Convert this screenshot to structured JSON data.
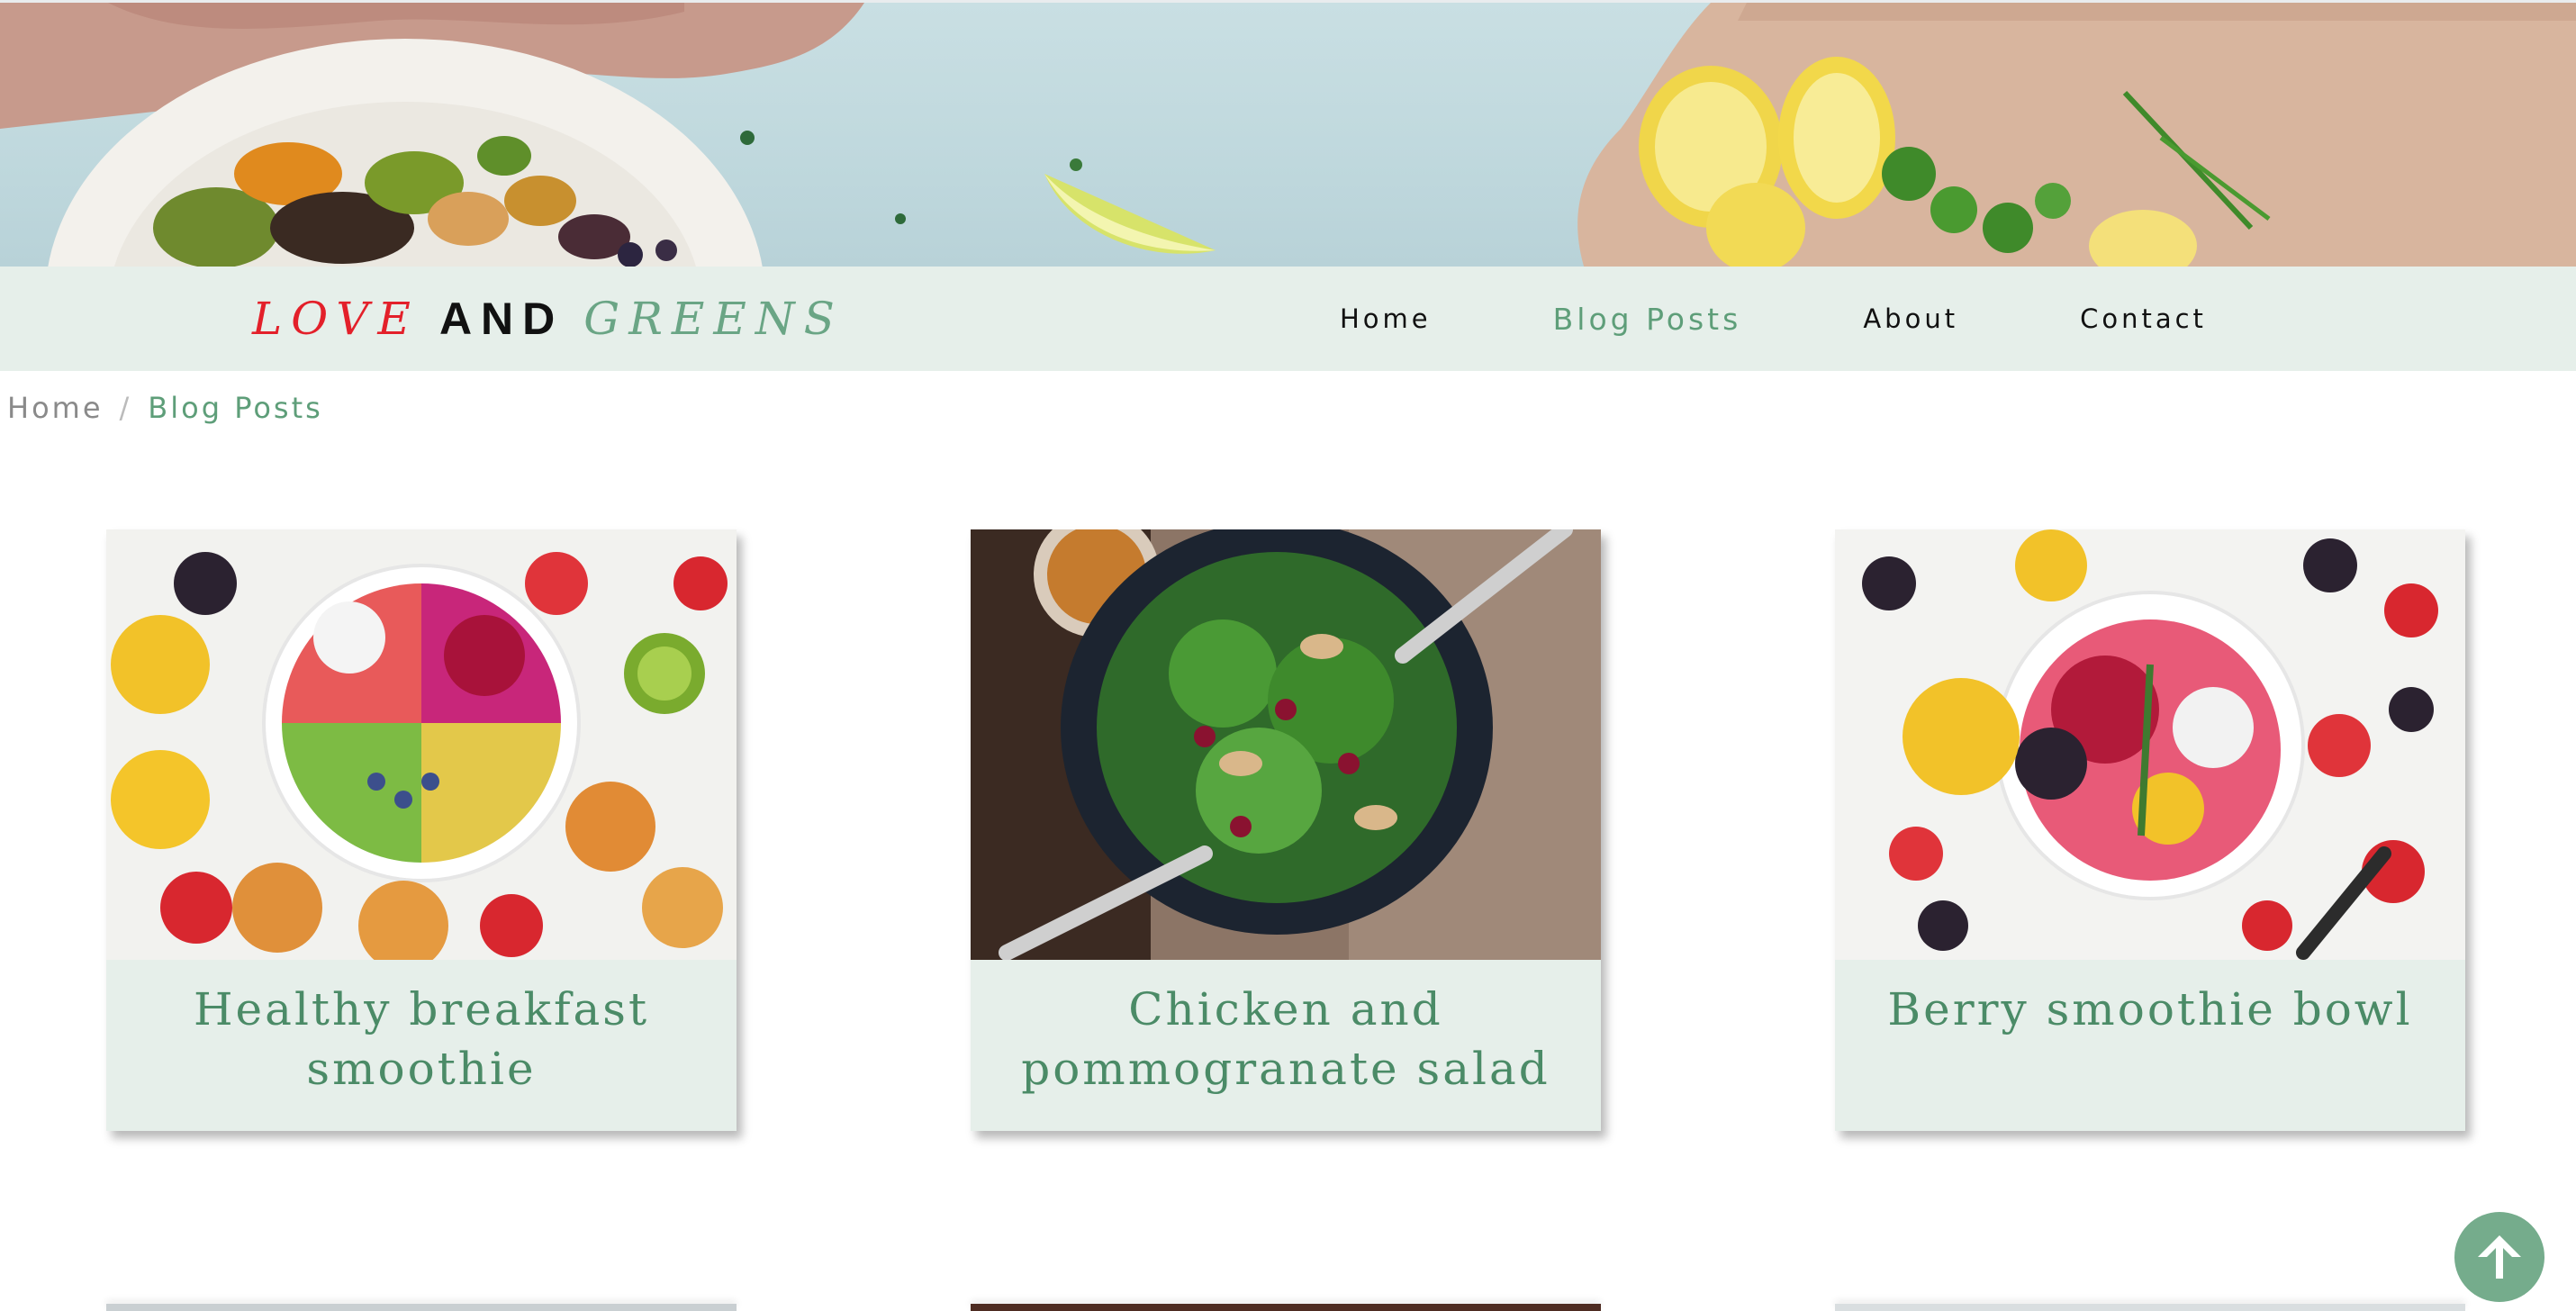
{
  "brand": {
    "love": "LOVE",
    "and": "AND",
    "greens": "GREENS"
  },
  "nav": {
    "items": [
      {
        "label": "Home"
      },
      {
        "label": "Blog Posts",
        "active": true
      },
      {
        "label": "About"
      },
      {
        "label": "Contact"
      }
    ]
  },
  "breadcrumb": {
    "home": "Home",
    "separator": "/",
    "current": "Blog Posts"
  },
  "posts": [
    {
      "title": "Healthy breakfast smoothie",
      "image": "smoothie-bowl-image"
    },
    {
      "title": "Chicken and pommogranate salad",
      "image": "salad-image"
    },
    {
      "title": "Berry smoothie bowl",
      "image": "berry-bowl-image"
    }
  ],
  "colors": {
    "accent_green": "#5e9e79",
    "nav_background": "#e6efea",
    "brand_red": "#e3202a"
  },
  "back_to_top": {
    "icon": "arrow-up-icon"
  }
}
